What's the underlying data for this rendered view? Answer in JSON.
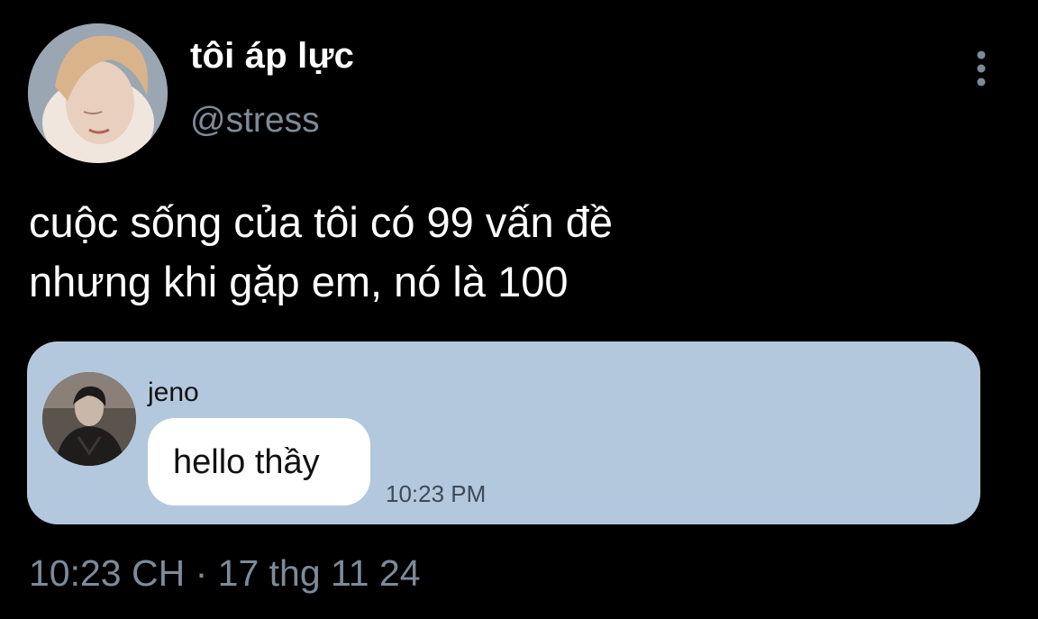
{
  "tweet": {
    "display_name": "tôi áp lực",
    "handle": "@stress",
    "text_lines": [
      "cuộc sống của tôi có 99 vấn đề",
      "nhưng khi gặp em, nó là 100"
    ],
    "timestamp": "10:23 CH",
    "separator": " · ",
    "date": "17 thg 11 24",
    "more_icon": "more-vertical-icon"
  },
  "chat": {
    "sender": "jeno",
    "message": "hello thầy",
    "time": "10:23 PM"
  },
  "colors": {
    "background": "#000000",
    "text_primary": "#ffffff",
    "text_secondary": "#7d8b99",
    "chat_card": "#b4c8dd",
    "chat_bubble": "#ffffff"
  }
}
